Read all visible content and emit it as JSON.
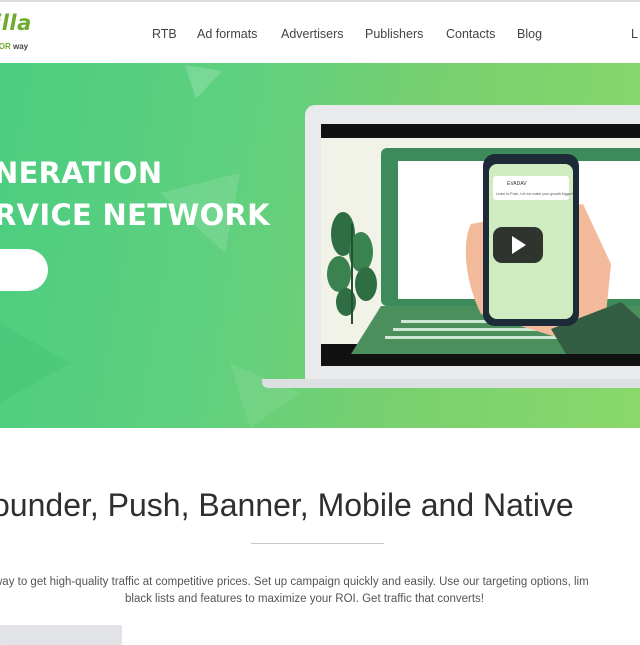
{
  "logo": {
    "main": "illa",
    "sub_colored": "TOR",
    "sub_dark": "way"
  },
  "nav": {
    "items": [
      "RTB",
      "Ad formats",
      "Advertisers",
      "Publishers",
      "Contacts",
      "Blog"
    ],
    "lang": "L"
  },
  "hero": {
    "title_line1": "NERATION",
    "title_line2": "RVICE NETWORK",
    "phone_app_name": "EVADAV",
    "phone_notification": "Learn to Push, Let me make your growth bigger!"
  },
  "section": {
    "title": "ounder, Push, Banner, Mobile and Native",
    "desc_line1": "way to get high-quality traffic at competitive prices. Set up campaign quickly and easily. Use our targeting options, lim",
    "desc_line2": "black lists and features to maximize your ROI. Get traffic that converts!"
  },
  "colors": {
    "brand_green": "#6fab2e",
    "hero_green": "#5fd07f"
  }
}
